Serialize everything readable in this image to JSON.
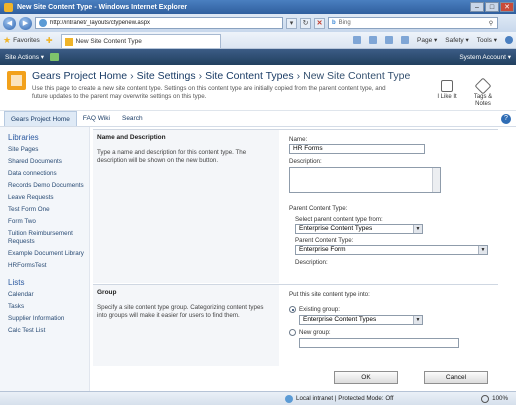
{
  "window": {
    "title": "New Site Content Type - Windows Internet Explorer"
  },
  "address": {
    "url": "http://intranet/_layouts/ctypenew.aspx",
    "search_placeholder": "Bing"
  },
  "favorites": {
    "label": "Favorites",
    "tab_title": "New Site Content Type",
    "tools": [
      "Page ▾",
      "Safety ▾",
      "Tools ▾"
    ]
  },
  "sp_topbar": {
    "site_actions": "Site Actions ▾",
    "account": "System Account ▾"
  },
  "header": {
    "breadcrumb": [
      "Gears Project Home",
      "Site Settings",
      "Site Content Types",
      "New Site Content Type"
    ],
    "description": "Use this page to create a new site content type. Settings on this content type are initially copied from the parent content type, and future updates to the parent may overwrite settings on this type.",
    "like_label": "I Like It",
    "tags_label": "Tags & Notes"
  },
  "topnav": {
    "items": [
      "Gears Project Home",
      "FAQ Wiki",
      "Search"
    ]
  },
  "quicklaunch": {
    "libraries_heading": "Libraries",
    "libraries": [
      "Site Pages",
      "Shared Documents",
      "Data connections",
      "Records Demo Documents",
      "Leave Requests",
      "Test Form One",
      "Form Two",
      "Tuition Reimbursement Requests",
      "Example Document Library",
      "HRFormsTest"
    ],
    "lists_heading": "Lists",
    "lists": [
      "Calendar",
      "Tasks",
      "Supplier Information",
      "Calc Test List"
    ]
  },
  "form": {
    "name_section": {
      "heading": "Name and Description",
      "description": "Type a name and description for this content type. The description will be shown on the new button.",
      "name_label": "Name:",
      "name_value": "HR Forms",
      "description_label": "Description:",
      "parent_heading": "Parent Content Type:",
      "select_from_label": "Select parent content type from:",
      "select_from_value": "Enterprise Content Types",
      "parent_label": "Parent Content Type:",
      "parent_value": "Enterprise Form",
      "parent_description_label": "Description:"
    },
    "group_section": {
      "heading": "Group",
      "description": "Specify a site content type group. Categorizing content types into groups will make it easier for users to find them.",
      "put_into_label": "Put this site content type into:",
      "existing_label": "Existing group:",
      "existing_value": "Enterprise Content Types",
      "new_label": "New group:"
    },
    "ok_label": "OK",
    "cancel_label": "Cancel"
  },
  "statusbar": {
    "zone": "Local intranet | Protected Mode: Off",
    "zoom": "100%"
  }
}
